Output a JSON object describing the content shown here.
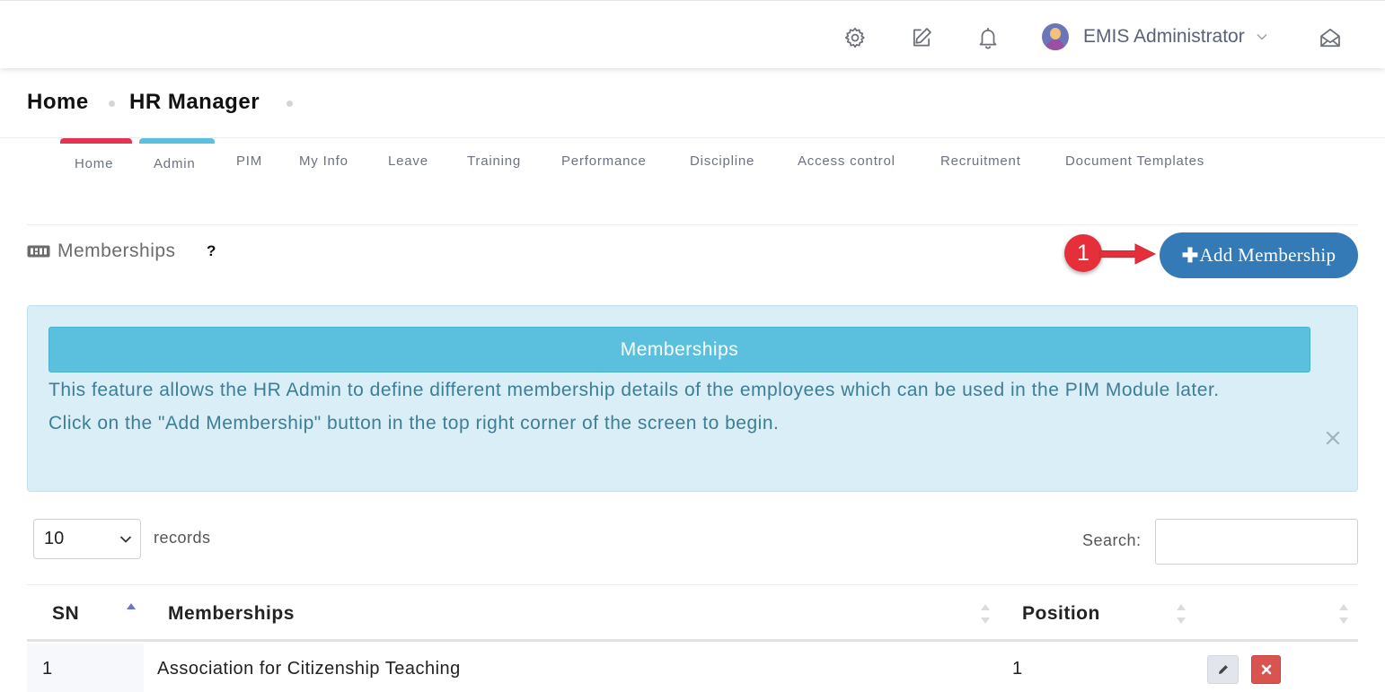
{
  "topbar": {
    "icons": [
      "gear-icon",
      "edit-icon",
      "bell-icon",
      "mail-open-icon"
    ],
    "user": {
      "name": "EMIS Administrator"
    }
  },
  "breadcrumb": {
    "items": [
      "Home",
      "HR Manager"
    ]
  },
  "modules": {
    "items": [
      "Home",
      "Admin",
      "PIM",
      "My Info",
      "Leave",
      "Training",
      "Performance",
      "Discipline",
      "Access control",
      "Recruitment",
      "Document Templates"
    ],
    "accent_colors": {
      "Home": "#e53355",
      "Admin": "#5bc0de"
    }
  },
  "section": {
    "title": "Memberships",
    "help": "?"
  },
  "annotation": {
    "number": "1",
    "color": "#e5303c"
  },
  "add_button": {
    "label": "Add Membership",
    "icon": "plus-icon",
    "color": "#337ab7"
  },
  "alert": {
    "heading": "Memberships",
    "line1": "This feature allows the HR Admin to define different membership details of the employees which can be used in the PIM Module later.",
    "line2": "Click on the \"Add Membership\" button in the top right corner of the screen to begin."
  },
  "table_controls": {
    "page_length": "10",
    "records_label": "records",
    "search_label": "Search:",
    "search_value": ""
  },
  "table": {
    "columns": [
      "SN",
      "Memberships",
      "Position",
      ""
    ],
    "rows": [
      {
        "sn": "1",
        "membership": "Association for Citizenship Teaching",
        "position": "1"
      }
    ]
  }
}
